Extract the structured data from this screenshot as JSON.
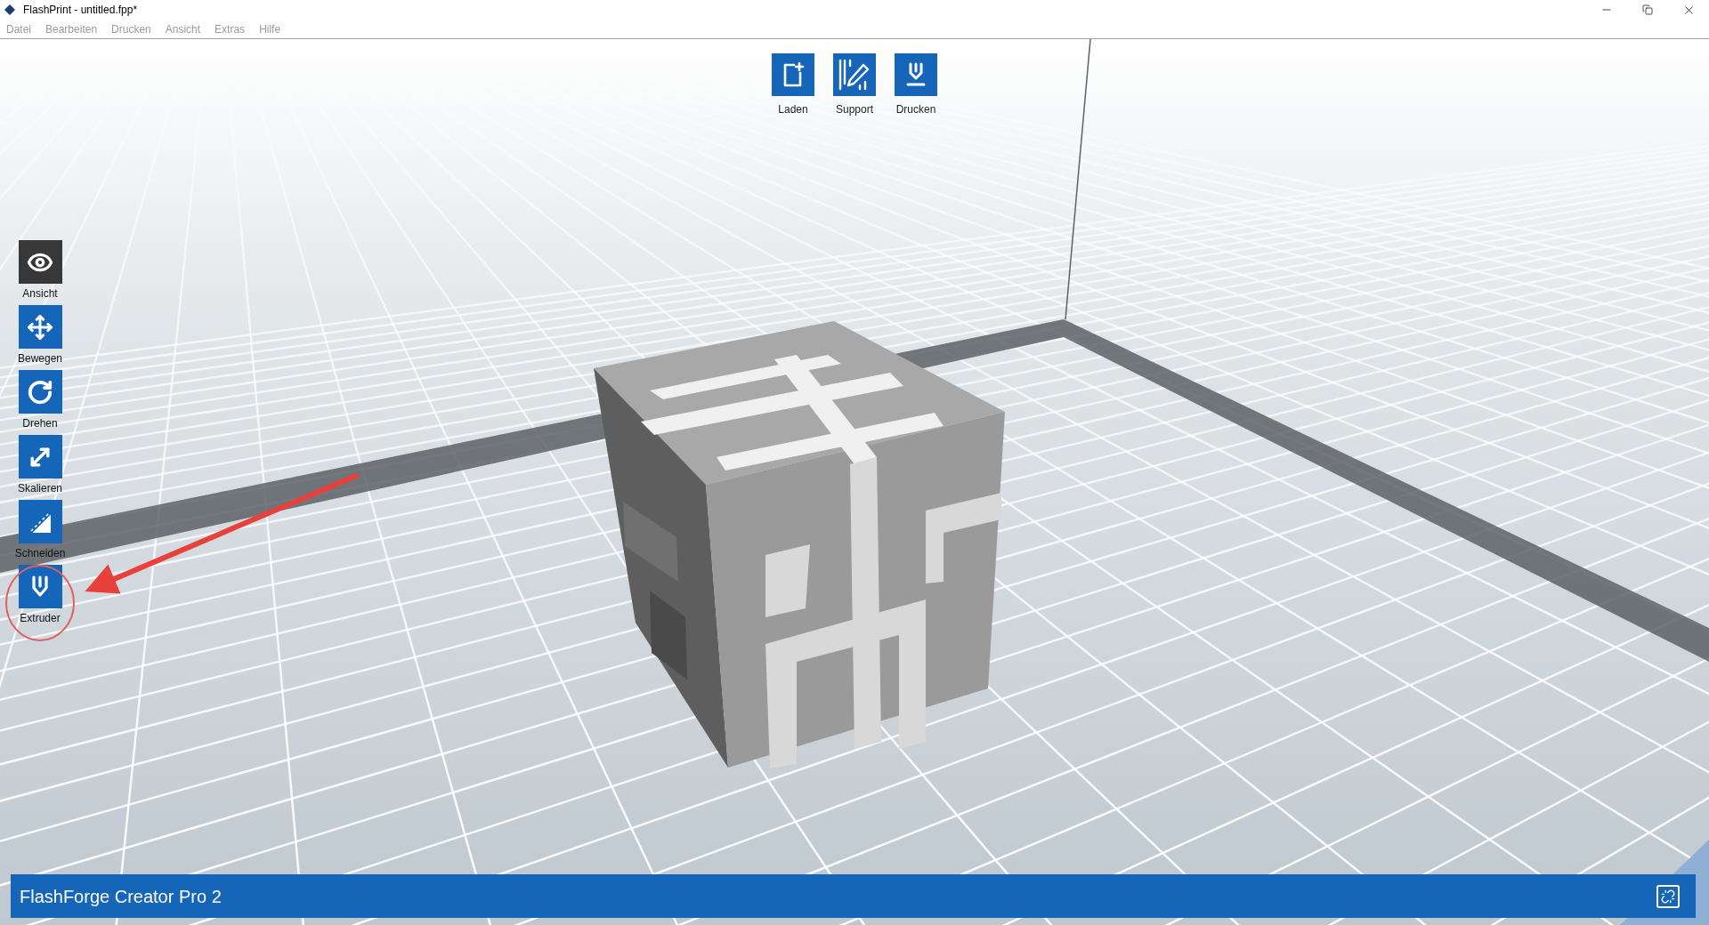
{
  "window": {
    "title": "FlashPrint - untitled.fpp*"
  },
  "menu": [
    "Datei",
    "Bearbeiten",
    "Drucken",
    "Ansicht",
    "Extras",
    "Hilfe"
  ],
  "top_toolbar": [
    {
      "label": "Laden",
      "kind": "load"
    },
    {
      "label": "Support",
      "kind": "support"
    },
    {
      "label": "Drucken",
      "kind": "print"
    }
  ],
  "left_toolbar": [
    {
      "label": "Ansicht",
      "kind": "view",
      "selected": true
    },
    {
      "label": "Bewegen",
      "kind": "move",
      "selected": false
    },
    {
      "label": "Drehen",
      "kind": "rotate",
      "selected": false
    },
    {
      "label": "Skalieren",
      "kind": "scale",
      "selected": false
    },
    {
      "label": "Schneiden",
      "kind": "cut",
      "selected": false
    },
    {
      "label": "Extruder",
      "kind": "extruder",
      "selected": false
    }
  ],
  "status_bar": {
    "printer": "FlashForge Creator Pro 2"
  }
}
